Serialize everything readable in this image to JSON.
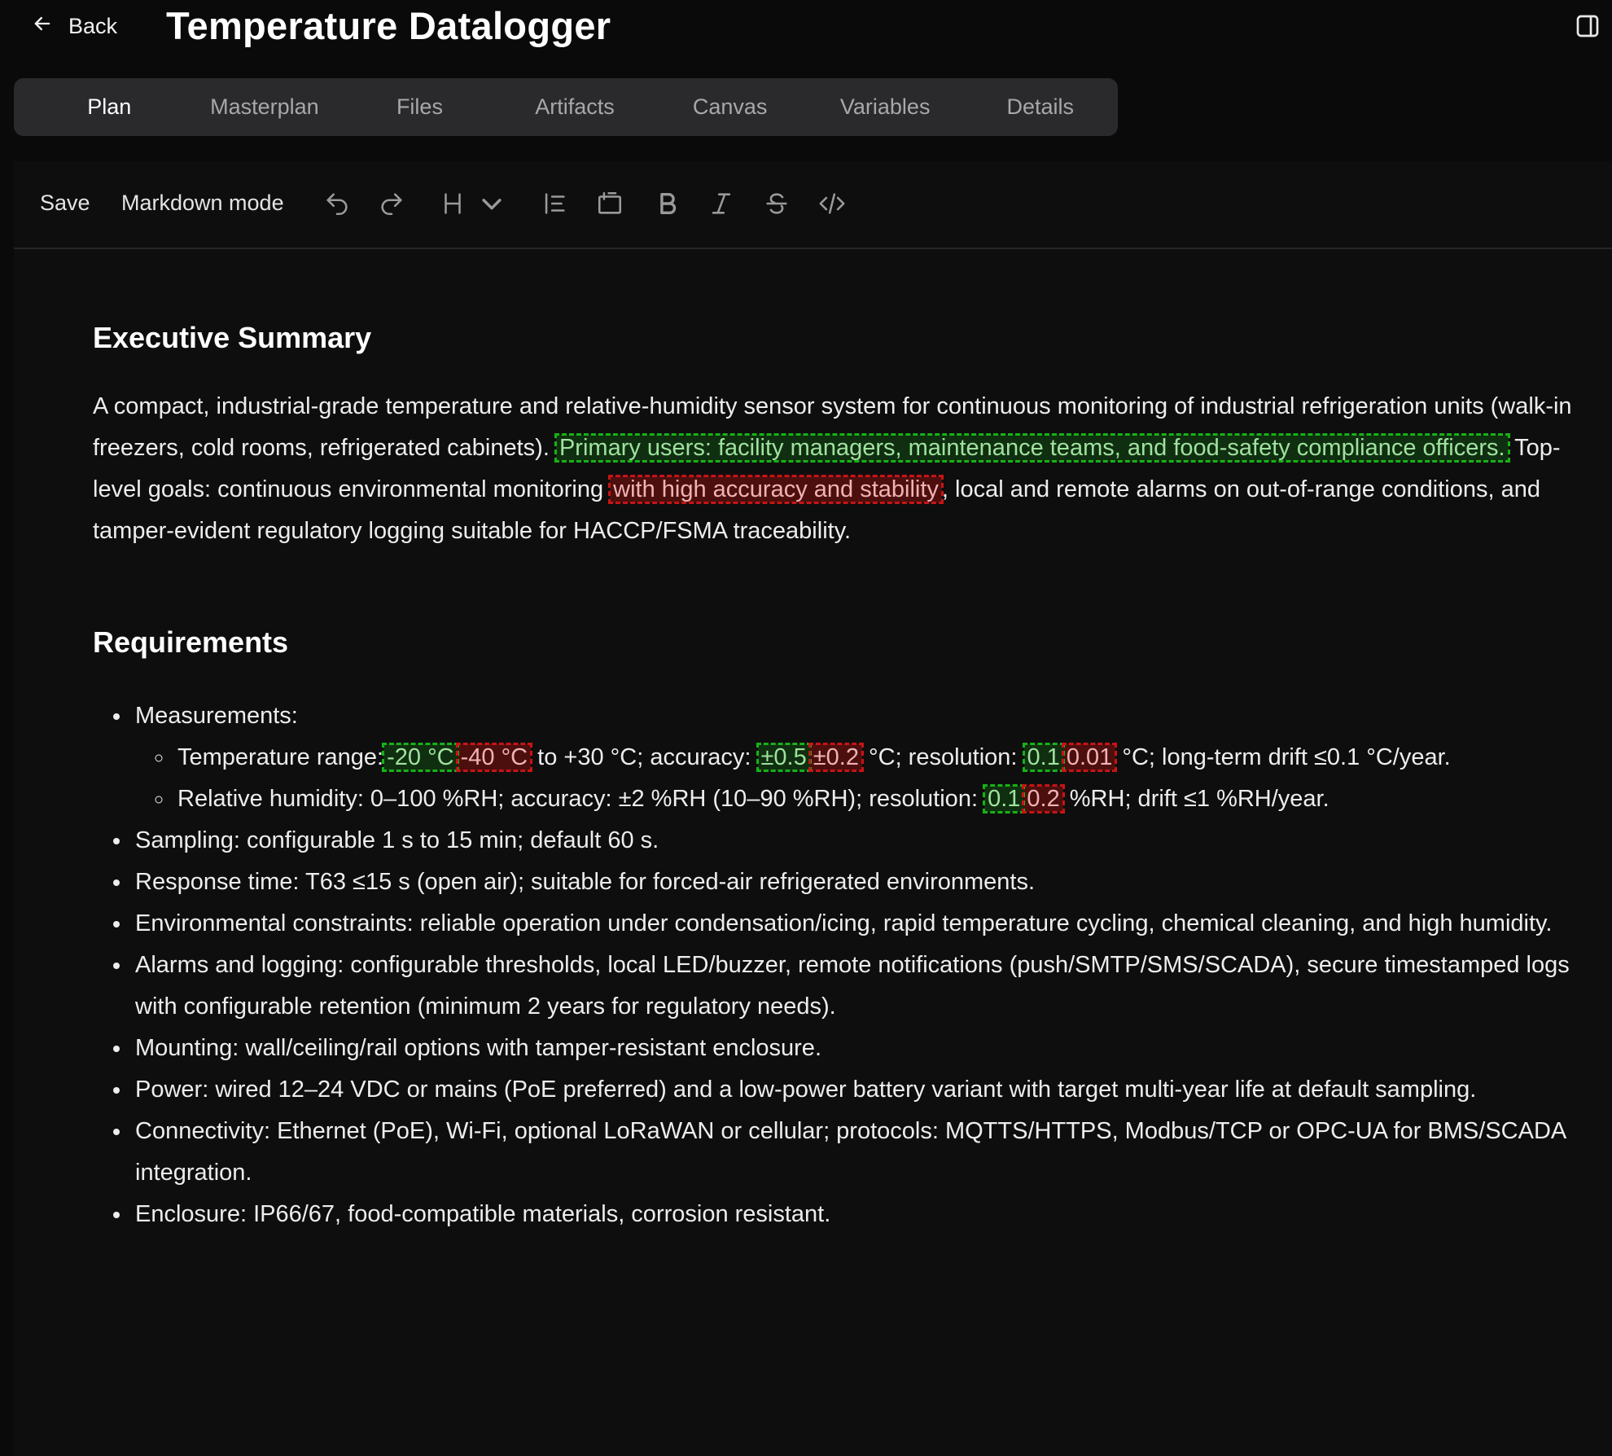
{
  "header": {
    "back_label": "Back",
    "title": "Temperature Datalogger",
    "back_icon": "arrow-left-icon",
    "panel_icon": "sidebar-toggle-icon"
  },
  "tabs": [
    {
      "label": "Plan",
      "active": true
    },
    {
      "label": "Masterplan"
    },
    {
      "label": "Files"
    },
    {
      "label": "Artifacts"
    },
    {
      "label": "Canvas"
    },
    {
      "label": "Variables"
    },
    {
      "label": "Details"
    }
  ],
  "toolbar": {
    "save_label": "Save",
    "markdown_label": "Markdown mode",
    "icons": [
      "undo-icon",
      "redo-icon",
      "heading-icon",
      "chevron-down-icon",
      "list-icon",
      "code-block-icon",
      "bold-icon",
      "italic-icon",
      "strikethrough-icon",
      "code-icon"
    ]
  },
  "doc": {
    "exec_heading": "Executive Summary",
    "exec": {
      "p1": "A compact, industrial-grade temperature and relative-humidity sensor system for continuous monitoring of industrial refrigeration units (walk-in freezers, cold rooms, refrigerated cabinets).",
      "add1": "Primary users: facility managers, maintenance teams, and food-safety compliance officers.",
      "p2": "Top-level goals: continuous environmental monitoring",
      "del1": "with high accuracy and stability",
      "p3": ", local and remote alarms on out-of-range conditions, and tamper-evident regulatory logging suitable for HACCP/FSMA traceability."
    },
    "req_heading": "Requirements",
    "req": {
      "measurements": "Measurements:",
      "temp": {
        "a": "Temperature range:",
        "add1": "-20 °C",
        "del1": "-40 °C",
        "b": " to +30 °C; accuracy: ",
        "add2": "±0.5",
        "del2": "±0.2",
        "c": " °C; resolution: ",
        "add3": "0.1",
        "del3": "0.01",
        "d": " °C; long-term drift ≤0.1 °C/year."
      },
      "rh": {
        "a": "Relative humidity: 0–100 %RH; accuracy: ±2 %RH (10–90 %RH); resolution: ",
        "add1": "0.1",
        "del1": "0.2",
        "b": " %RH; drift ≤1 %RH/year."
      },
      "items": [
        "Sampling: configurable 1 s to 15 min; default 60 s.",
        "Response time: T63 ≤15 s (open air); suitable for forced-air refrigerated environments.",
        "Environmental constraints: reliable operation under condensation/icing, rapid temperature cycling, chemical cleaning, and high humidity.",
        "Alarms and logging: configurable thresholds, local LED/buzzer, remote notifications (push/SMTP/SMS/SCADA), secure timestamped logs with configurable retention (minimum 2 years for regulatory needs).",
        "Mounting: wall/ceiling/rail options with tamper-resistant enclosure.",
        "Power: wired 12–24 VDC or mains (PoE preferred) and a low-power battery variant with target multi-year life at default sampling.",
        "Connectivity: Ethernet (PoE), Wi-Fi, optional LoRaWAN or cellular; protocols: MQTTS/HTTPS, Modbus/TCP or OPC-UA for BMS/SCADA integration.",
        "Enclosure: IP66/67, food-compatible materials, corrosion resistant."
      ]
    }
  }
}
